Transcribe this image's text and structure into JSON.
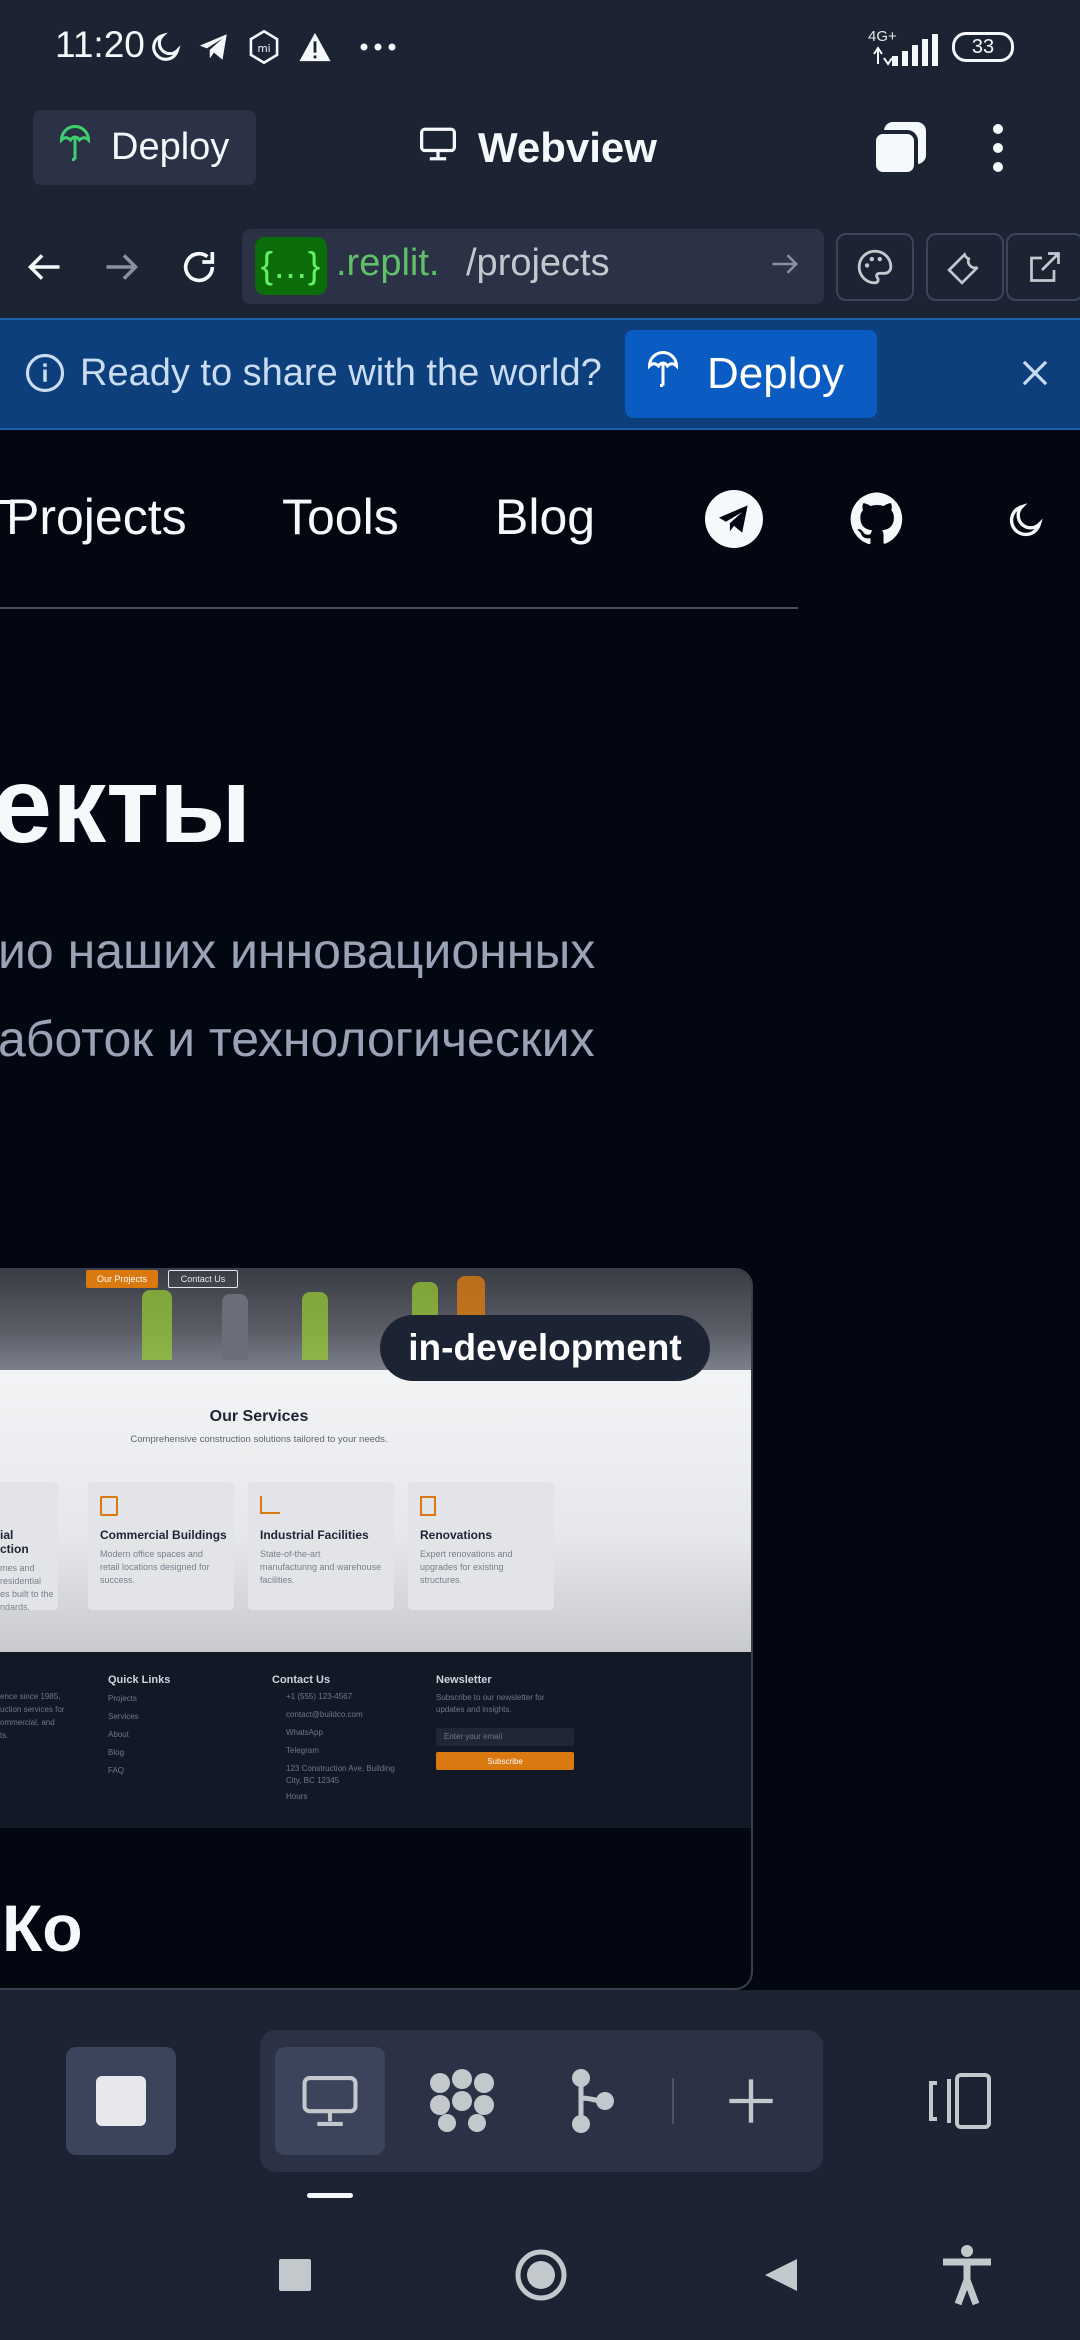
{
  "status_bar": {
    "time": "11:20",
    "network": "4G+",
    "battery": "33"
  },
  "app_bar": {
    "deploy_label": "Deploy",
    "webview_label": "Webview"
  },
  "url_bar": {
    "repl_badge": "{...}",
    "domain": ".replit.",
    "path": "/projects"
  },
  "banner": {
    "text": "Ready to share with the world?",
    "deploy_label": "Deploy"
  },
  "site": {
    "nav": [
      "Projects",
      "Tools",
      "Blog"
    ],
    "heading": "екты",
    "description_line1": "ио наших инновационных",
    "description_line2": "аботок и технологических",
    "card": {
      "badge": "in-development",
      "hero_buttons": [
        "Our Projects",
        "Contact Us"
      ],
      "services_title": "Our Services",
      "services_subtitle": "Comprehensive construction solutions tailored to your needs.",
      "services": [
        {
          "title": "ial\nction",
          "desc": "mes and residential\nes built to the\nndards."
        },
        {
          "title": "Commercial Buildings",
          "desc": "Modern office spaces and\nretail locations designed for\nsuccess."
        },
        {
          "title": "Industrial Facilities",
          "desc": "State-of-the-art\nmanufacturing and warehouse\nfacilities."
        },
        {
          "title": "Renovations",
          "desc": "Expert renovations and\nupgrades for existing\nstructures."
        }
      ],
      "footer": {
        "about_text": "ence since 1985,\nuction services for\nommercial, and\nts.",
        "quick_links_title": "Quick Links",
        "quick_links": [
          "Projects",
          "Services",
          "About",
          "Blog",
          "FAQ"
        ],
        "contact_title": "Contact Us",
        "contact_items": [
          "+1 (555) 123-4567",
          "contact@buildco.com",
          "WhatsApp",
          "Telegram",
          "123 Construction Ave, Building",
          "City, BC 12345",
          "Hours"
        ],
        "newsletter_title": "Newsletter",
        "newsletter_text": "Subscribe to our newsletter for\nupdates and insights.",
        "email_placeholder": "Enter your email",
        "subscribe_label": "Subscribe"
      },
      "next_title": "Ко"
    }
  },
  "colors": {
    "accent_blue": "#0a5bc2",
    "banner_bg": "#0c3f7c",
    "replit_green": "#64f066",
    "page_bg": "#030712",
    "chrome_bg": "#1c2333",
    "orange": "#d9790f"
  }
}
